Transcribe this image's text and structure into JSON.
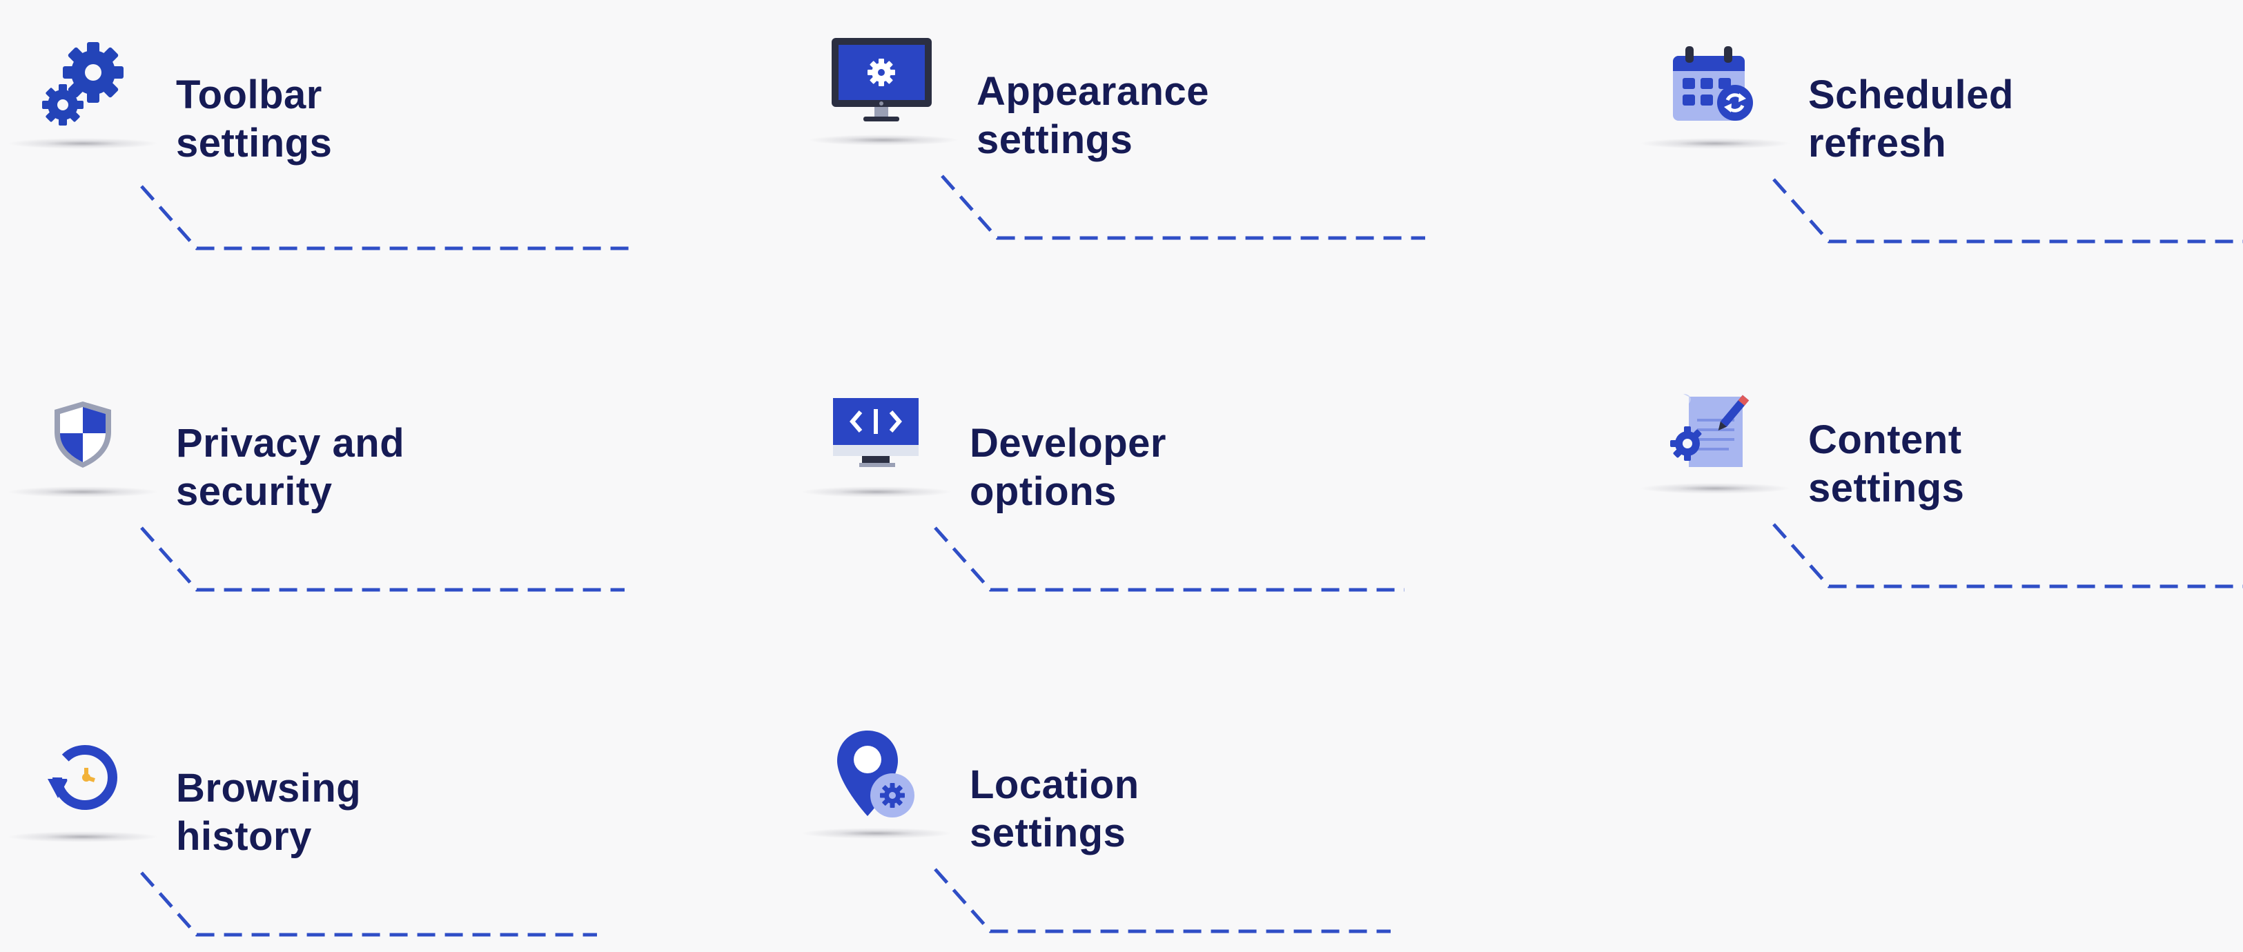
{
  "colors": {
    "background": "#f8f8f9",
    "title": "#161b55",
    "accent": "#2f4ec6",
    "dash": "#2f4ec6"
  },
  "tiles": [
    {
      "id": "toolbar",
      "icon": "gears-icon",
      "line1": "Toolbar",
      "line2": "settings"
    },
    {
      "id": "appearance",
      "icon": "monitor-gear-icon",
      "line1": "Appearance",
      "line2": "settings"
    },
    {
      "id": "scheduled",
      "icon": "calendar-refresh-icon",
      "line1": "Scheduled",
      "line2": "refresh"
    },
    {
      "id": "privacy",
      "icon": "shield-icon",
      "line1": "Privacy and",
      "line2": "security"
    },
    {
      "id": "developer",
      "icon": "code-monitor-icon",
      "line1": "Developer",
      "line2": "options"
    },
    {
      "id": "content",
      "icon": "document-pen-icon",
      "line1": "Content",
      "line2": "settings"
    },
    {
      "id": "history",
      "icon": "history-icon",
      "line1": "Browsing",
      "line2": "history"
    },
    {
      "id": "location",
      "icon": "location-pin-gear-icon",
      "line1": "Location",
      "line2": "settings"
    }
  ]
}
